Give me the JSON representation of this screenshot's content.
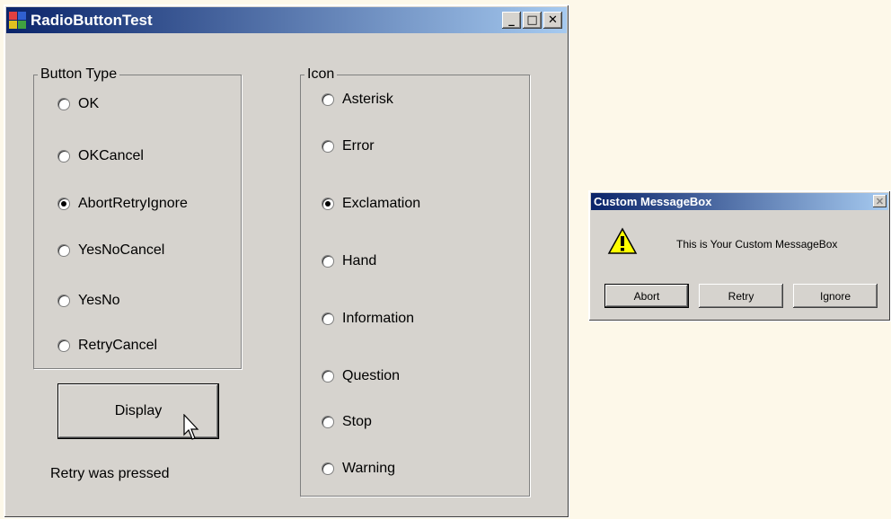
{
  "main_window": {
    "title": "RadioButtonTest",
    "buttons": {
      "minimize": "_",
      "maximize": "□",
      "close": "✕"
    }
  },
  "button_type_group": {
    "label": "Button Type",
    "options": [
      {
        "label": "OK",
        "selected": false
      },
      {
        "label": "OKCancel",
        "selected": false
      },
      {
        "label": "AbortRetryIgnore",
        "selected": true
      },
      {
        "label": "YesNoCancel",
        "selected": false
      },
      {
        "label": "YesNo",
        "selected": false
      },
      {
        "label": "RetryCancel",
        "selected": false
      }
    ]
  },
  "icon_group": {
    "label": "Icon",
    "options": [
      {
        "label": "Asterisk",
        "selected": false
      },
      {
        "label": "Error",
        "selected": false
      },
      {
        "label": "Exclamation",
        "selected": true
      },
      {
        "label": "Hand",
        "selected": false
      },
      {
        "label": "Information",
        "selected": false
      },
      {
        "label": "Question",
        "selected": false
      },
      {
        "label": "Stop",
        "selected": false
      },
      {
        "label": "Warning",
        "selected": false
      }
    ]
  },
  "display_button": {
    "label": "Display"
  },
  "status_text": "Retry was pressed",
  "message_box": {
    "title": "Custom MessageBox",
    "close": "✕",
    "icon": "warning-icon",
    "text": "This is Your Custom MessageBox",
    "buttons": [
      "Abort",
      "Retry",
      "Ignore"
    ]
  },
  "colors": {
    "window_bg": "#d6d3ce",
    "title_start": "#0a246a",
    "title_end": "#a6caf0",
    "desktop": "#fdf8e9"
  }
}
